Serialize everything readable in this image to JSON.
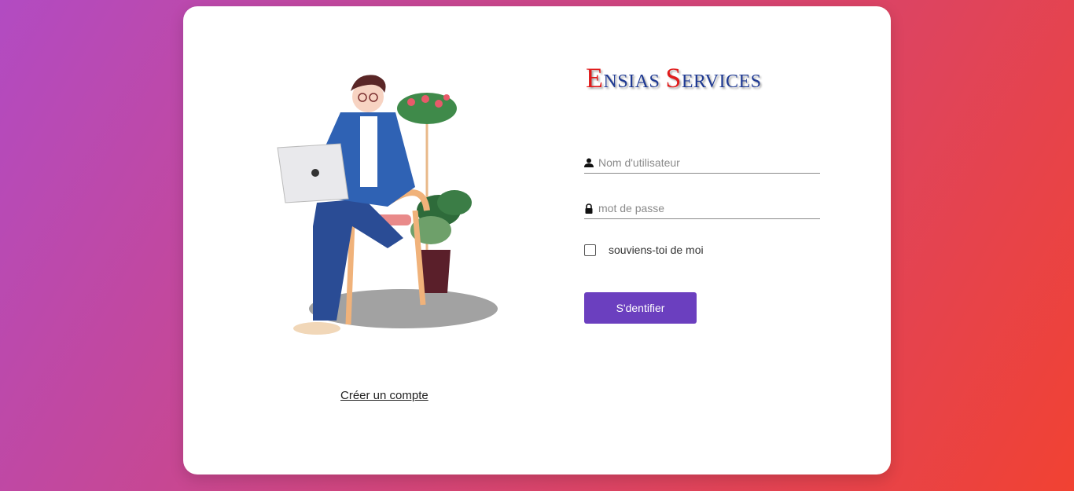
{
  "brand": {
    "e_initial": "E",
    "e_rest": "NSIAS",
    "s_initial": "S",
    "s_rest": "ERVICES",
    "colors": {
      "initials": "#e01b1b",
      "rest": "#1f3a93"
    }
  },
  "form": {
    "username_placeholder": "Nom d'utilisateur",
    "password_placeholder": "mot de passe",
    "remember_label": "souviens-toi de moi",
    "remember_checked": false,
    "submit_label": "S'dentifier"
  },
  "links": {
    "create_account": "Créer un compte"
  },
  "icons": {
    "username": "user-icon",
    "password": "lock-icon"
  },
  "colors": {
    "button": "#6b3fbf",
    "card": "#ffffff",
    "background_start": "#b24bc2",
    "background_end": "#f14232"
  }
}
